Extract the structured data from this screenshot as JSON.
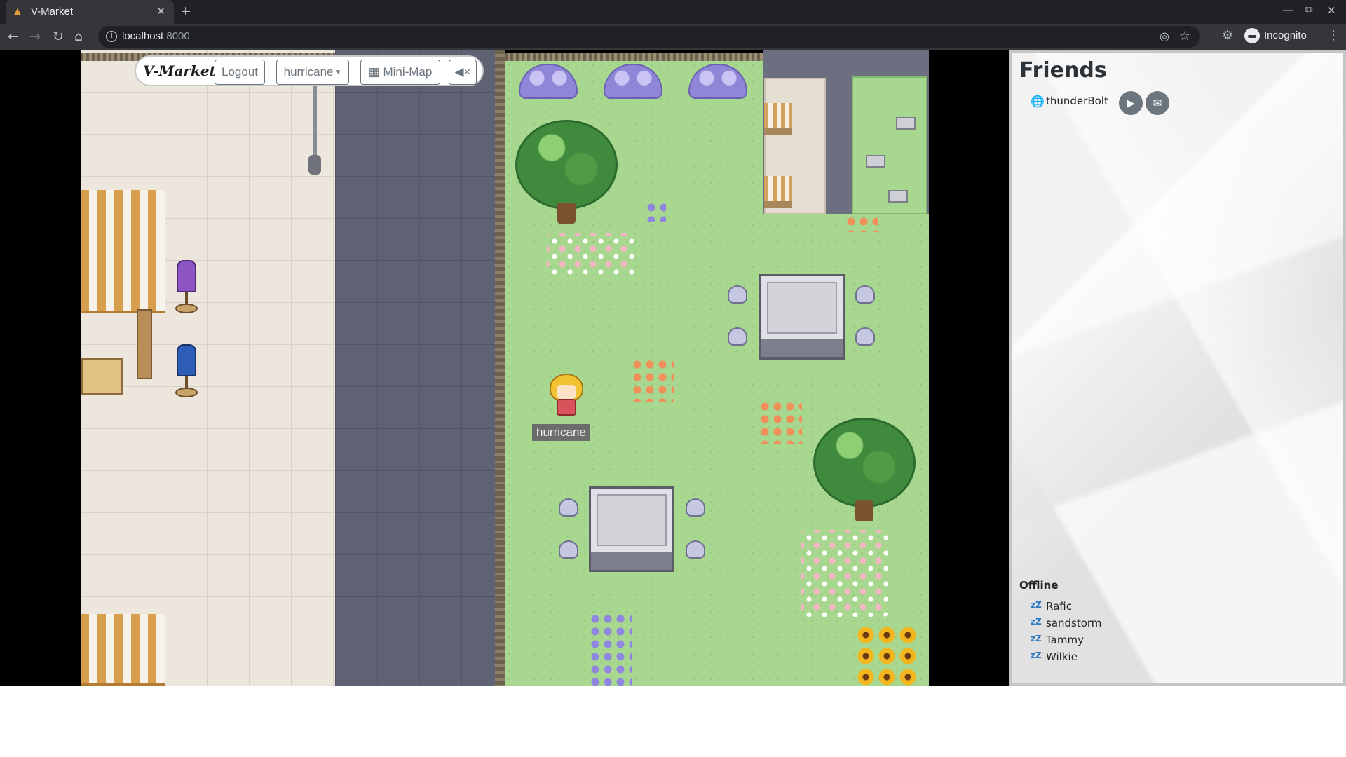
{
  "browser": {
    "tab_title": "V-Market",
    "url_host": "localhost",
    "url_port": ":8000",
    "profile_label": "Incognito",
    "icons": [
      "back-icon",
      "forward-icon",
      "reload-icon",
      "home-icon",
      "info-icon",
      "eye-off-icon",
      "star-icon",
      "extensions-icon",
      "incognito-icon",
      "kebab-menu-icon"
    ]
  },
  "hud": {
    "brand": "V-Market",
    "logout_label": "Logout",
    "user_dropdown_label": "hurricane",
    "minimap_label": "Mini-Map",
    "mute_icon": "volume-mute-icon"
  },
  "game": {
    "player_name": "hurricane"
  },
  "friends": {
    "title": "Friends",
    "online": [
      {
        "name": "thunderBolt",
        "status_icon": "globe-icon"
      }
    ],
    "online_actions": [
      "video-call-icon",
      "chat-icon"
    ],
    "offline_title": "Offline",
    "offline": [
      {
        "name": "Rafic"
      },
      {
        "name": "sandstorm"
      },
      {
        "name": "Tammy"
      },
      {
        "name": "Wilkie"
      }
    ]
  },
  "colors": {
    "browser_dark": "#202124",
    "toolbar": "#35363a",
    "grass": "#a8d890",
    "road": "#5f6273",
    "button_outline": "#6c757d"
  }
}
